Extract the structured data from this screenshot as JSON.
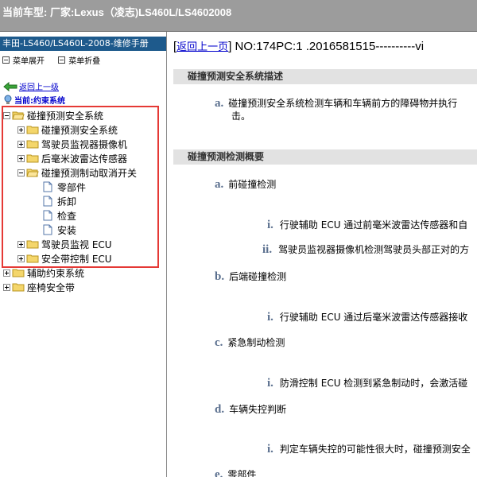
{
  "topbar": {
    "text": "当前车型:  厂家:Lexus（凌志)LS460L/LS4602008"
  },
  "sidebar": {
    "manual_title": "丰田-LS460/LS460L-2008-维修手册",
    "expand_label": "菜单展开",
    "collapse_label": "菜单折叠",
    "back_label": "返回上一级",
    "current_label": "当前:约束系统",
    "tree": {
      "root": "碰撞预测安全系统",
      "children": [
        "碰撞预测安全系统",
        "驾驶员监视器摄像机",
        "后毫米波雷达传感器",
        "碰撞预测制动取消开关"
      ],
      "leaves": [
        "零部件",
        "拆卸",
        "检查",
        "安装"
      ],
      "after": [
        "驾驶员监视 ECU",
        "安全带控制 ECU"
      ],
      "siblings": [
        "辅助约束系统",
        "座椅安全带"
      ]
    }
  },
  "content": {
    "back_link": "返回上一页",
    "doc_id": " NO:174PC:1 .2016581515----------vi",
    "section1_title": "碰撞预测安全系统描述",
    "s1_item_a_marker": "a.",
    "s1_item_a_line1": "碰撞预测安全系统检测车辆和车辆前方的障碍物并执行",
    "s1_item_a_line2": "击。",
    "section2_title": "碰撞预测检测概要",
    "items": [
      {
        "marker": "a.",
        "text": "前碰撞检测"
      },
      {
        "marker": "i.",
        "text": "行驶辅助 ECU 通过前毫米波雷达传感器和自"
      },
      {
        "marker": "ii.",
        "text": "驾驶员监视器摄像机检测驾驶员头部正对的方"
      },
      {
        "marker": "b.",
        "text": "后端碰撞检测"
      },
      {
        "marker": "i.",
        "text": "行驶辅助 ECU 通过后毫米波雷达传感器接收"
      },
      {
        "marker": "c.",
        "text": "紧急制动检测"
      },
      {
        "marker": "i.",
        "text": "防滑控制 ECU 检测到紧急制动时，会激活碰"
      },
      {
        "marker": "d.",
        "text": "车辆失控判断"
      },
      {
        "marker": "i.",
        "text": "判定车辆失控的可能性很大时，碰撞预测安全"
      },
      {
        "marker": "e.",
        "text": "零部件"
      }
    ]
  },
  "colors": {
    "topbar": "#9c9c9c",
    "manual_title_bg": "#1e5a8c",
    "highlight": "#e53935",
    "link": "#0000cc",
    "marker": "#5a6f8e",
    "section_bg": "#e2e2e2"
  }
}
